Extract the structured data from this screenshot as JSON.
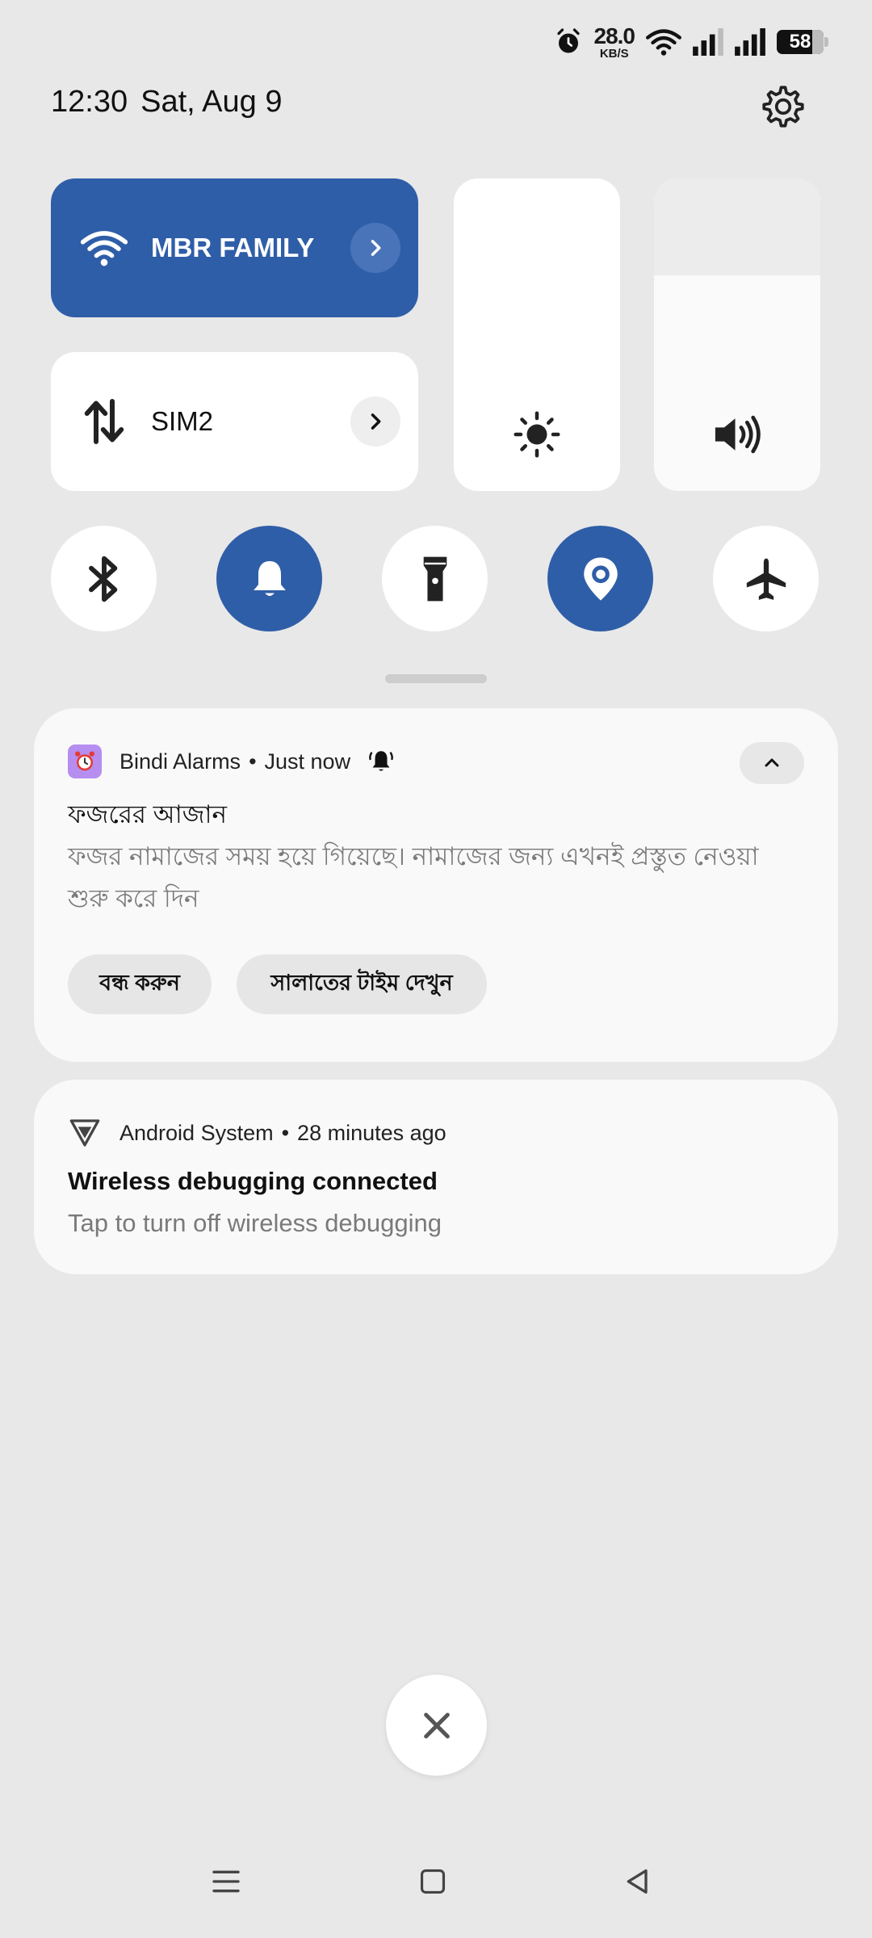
{
  "status_bar": {
    "net_speed_value": "28.0",
    "net_speed_unit": "KB/S",
    "battery_level": "58",
    "icons": [
      "alarm-icon",
      "wifi-icon",
      "signal-sim1-icon",
      "signal-sim2-icon",
      "battery-icon"
    ]
  },
  "header": {
    "time": "12:30",
    "date": "Sat, Aug 9"
  },
  "tiles": {
    "wifi": {
      "label": "MBR FAMILY",
      "state": "on",
      "icon": "wifi-icon"
    },
    "mobile_data": {
      "label": "SIM2",
      "state": "off",
      "icon": "data-arrows-icon"
    },
    "brightness": {
      "icon": "sun-icon",
      "level": 1.0
    },
    "volume": {
      "icon": "speaker-icon",
      "level": 0.69
    },
    "round_toggles": [
      {
        "name": "bluetooth",
        "icon": "bluetooth-icon",
        "state": "off"
      },
      {
        "name": "ring",
        "icon": "bell-icon",
        "state": "on"
      },
      {
        "name": "flashlight",
        "icon": "flashlight-icon",
        "state": "off"
      },
      {
        "name": "location",
        "icon": "location-pin-icon",
        "state": "on"
      },
      {
        "name": "airplane",
        "icon": "airplane-icon",
        "state": "off"
      }
    ]
  },
  "notifications": [
    {
      "app": "Bindi Alarms",
      "time": "Just now",
      "title": "ফজরের আজান",
      "body": "ফজর নামাজের সময় হয়ে গিয়েছে। নামাজের জন্য এখনই প্রস্তুত নেওয়া শুরু করে দিন",
      "actions": [
        "বন্ধ করুন",
        "সালাতের টাইম দেখুন"
      ]
    },
    {
      "app": "Android System",
      "time": "28 minutes ago",
      "title": "Wireless debugging connected",
      "body": "Tap to turn off wireless debugging"
    }
  ],
  "colors": {
    "accent": "#2f5ea8",
    "background": "#e8e8e8",
    "card": "#f9f9f9",
    "alarm_app_icon": "#b58ef0"
  }
}
